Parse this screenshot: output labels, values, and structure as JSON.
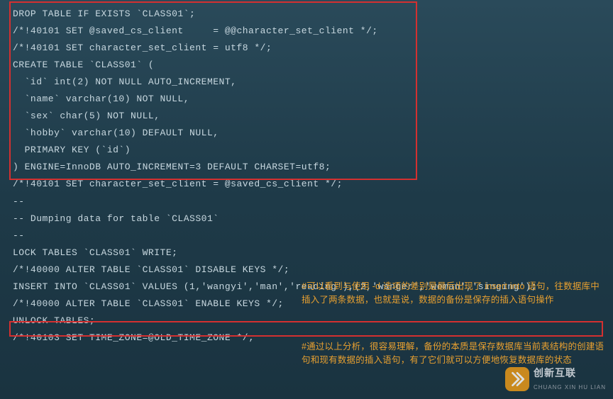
{
  "code_lines": [
    "DROP TABLE IF EXISTS `CLASS01`;",
    "/*!40101 SET @saved_cs_client     = @@character_set_client */;",
    "/*!40101 SET character_set_client = utf8 */;",
    "CREATE TABLE `CLASS01` (",
    "  `id` int(2) NOT NULL AUTO_INCREMENT,",
    "  `name` varchar(10) NOT NULL,",
    "  `sex` char(5) NOT NULL,",
    "  `hobby` varchar(10) DEFAULT NULL,",
    "  PRIMARY KEY (`id`)",
    ") ENGINE=InnoDB AUTO_INCREMENT=3 DEFAULT CHARSET=utf8;",
    "/*!40101 SET character_set_client = @saved_cs_client */;",
    "",
    "--",
    "-- Dumping data for table `CLASS01`",
    "--",
    "",
    "LOCK TABLES `CLASS01` WRITE;",
    "/*!40000 ALTER TABLE `CLASS01` DISABLE KEYS */;",
    "INSERT INTO `CLASS01` VALUES (1,'wangyi','man','reading'),(2,'wanger','woman','singing');",
    "/*!40000 ALTER TABLE `CLASS01` ENABLE KEYS */;",
    "UNLOCK TABLES;",
    "/*!40103 SET TIME_ZONE=@OLD_TIME_ZONE */;"
  ],
  "annotations": {
    "anno1": "#可以看到与使用 -d 选项的差别是最后出现了 insert into 语句，往数据库中插入了两条数据，也就是说，数据的备份是保存的插入语句操作",
    "anno2": "#通过以上分析，很容易理解，备份的本质是保存数据库当前表结构的创建语句和现有数据的插入语句，有了它们就可以方便地恢复数据库的状态"
  },
  "watermark": {
    "cn": "创新互联",
    "en": "CHUANG XIN HU LIAN"
  }
}
